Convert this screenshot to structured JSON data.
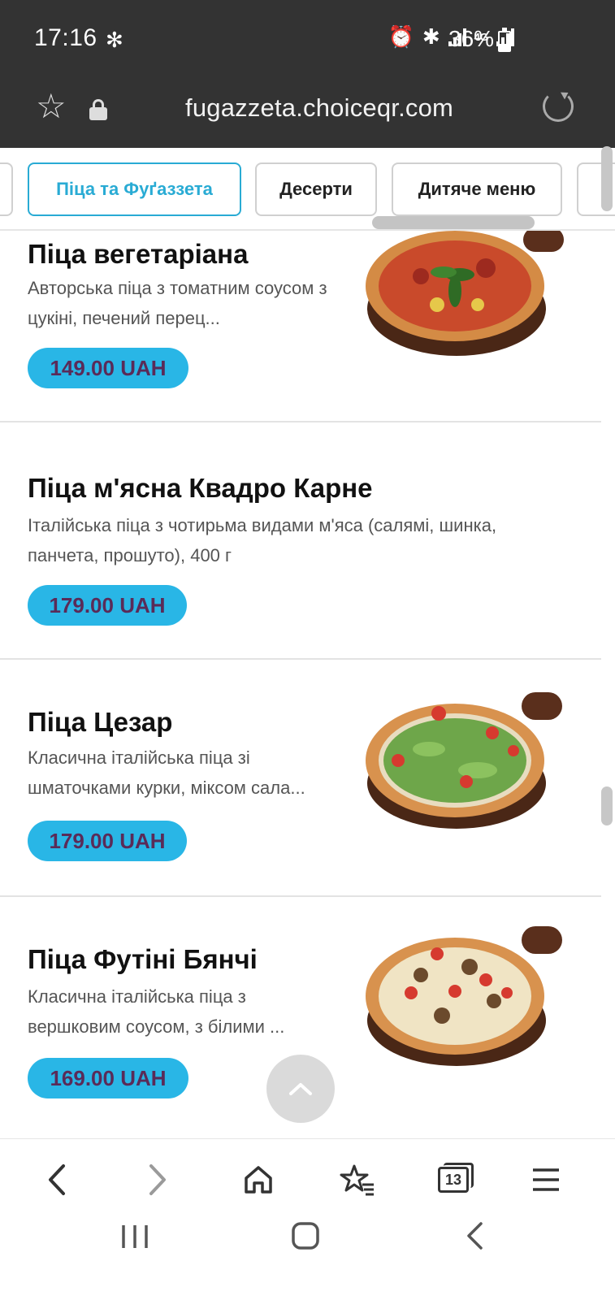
{
  "status_bar": {
    "time": "17:16",
    "battery": "36%",
    "battery_level": 0.36,
    "network": "4G"
  },
  "browser": {
    "url": "fugazzeta.choiceqr.com"
  },
  "categories": [
    {
      "label": "Піца та Фуґаззета",
      "active": true
    },
    {
      "label": "Десерти",
      "active": false
    },
    {
      "label": "Дитяче меню",
      "active": false
    }
  ],
  "menu_items": [
    {
      "title": "Піца вегетаріана",
      "description": "Авторська піца з томатним соусом з цукіні, печений перец...",
      "price": "149.00 UAH",
      "image": "pizza-vegetarian"
    },
    {
      "title": "Піца м'ясна Квадро Карне",
      "description": "Італійська піца з чотирьма видами м'яса (салямі, шинка, панчета, прошуто), 400 г",
      "price": "179.00 UAH",
      "image": ""
    },
    {
      "title": "Піца Цезар",
      "description": "Класична італійська піца зі шматочками курки, міксом сала...",
      "price": "179.00 UAH",
      "image": "pizza-caesar"
    },
    {
      "title": "Піца Футіні Бянчі",
      "description": "Класична італійська піца з вершковим соусом, з білими ...",
      "price": "169.00 UAH",
      "image": "pizza-funghi-bianchi"
    }
  ],
  "toolbar": {
    "tab_count": "13"
  },
  "colors": {
    "accent": "#29abd4",
    "price_bg": "#29b6e6",
    "price_text": "#5a2b58",
    "chrome": "#333333"
  }
}
